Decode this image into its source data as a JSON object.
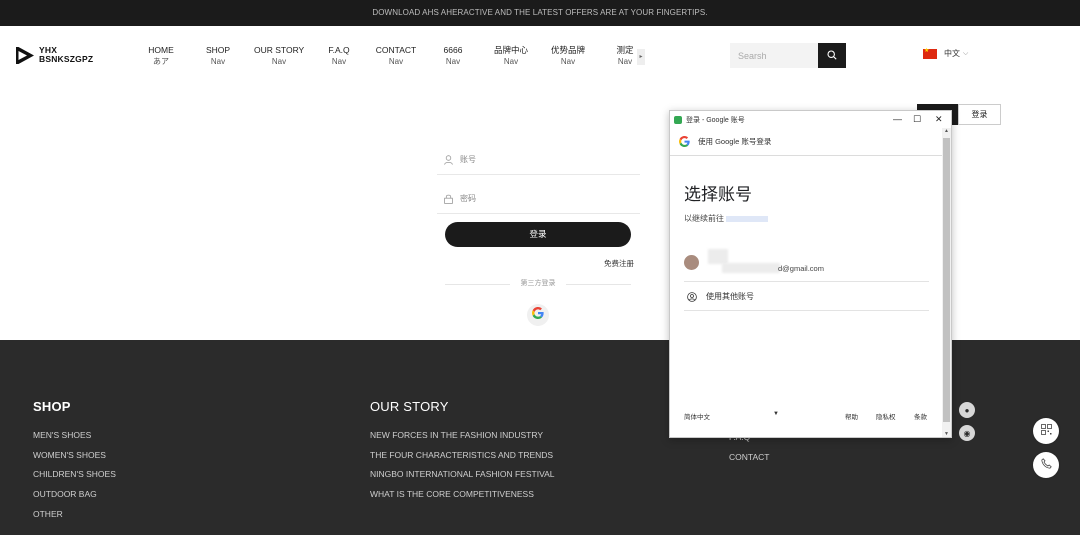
{
  "announcement": "DOWNLOAD AHS AHERACTIVE AND THE LATEST OFFERS ARE AT YOUR FINGERTIPS.",
  "logo": {
    "line1": "YHX",
    "line2": "BSNKSZGPZ"
  },
  "nav": [
    {
      "label": "HOME",
      "sub": "あア"
    },
    {
      "label": "SHOP",
      "sub": "Nav"
    },
    {
      "label": "OUR STORY",
      "sub": "Nav"
    },
    {
      "label": "F.A.Q",
      "sub": "Nav"
    },
    {
      "label": "CONTACT",
      "sub": "Nav"
    },
    {
      "label": "6666",
      "sub": "Nav"
    },
    {
      "label": "品牌中心",
      "sub": "Nav"
    },
    {
      "label": "优势品牌",
      "sub": "Nav"
    },
    {
      "label": "测定",
      "sub": "Nav"
    }
  ],
  "search": {
    "placeholder": "Searsh"
  },
  "language": {
    "label": "中文"
  },
  "header_buttons": {
    "login": "登录"
  },
  "login_form": {
    "username_placeholder": "账号",
    "password_placeholder": "密码",
    "submit": "登录",
    "register": "免费注册",
    "third_party": "第三方登录"
  },
  "popup": {
    "window_title": "登录 - Google 账号",
    "header": "使用 Google 账号登录",
    "heading": "选择账号",
    "continue_to": "以继续前往",
    "account_email": "d@gmail.com",
    "use_other": "使用其他账号",
    "footer_lang": "简体中文",
    "help": "帮助",
    "privacy": "隐私权",
    "terms": "条款"
  },
  "footer": {
    "shop": {
      "title": "SHOP",
      "links": [
        "MEN'S SHOES",
        "WOMEN'S SHOES",
        "CHILDREN'S SHOES",
        "OUTDOOR BAG",
        "OTHER"
      ]
    },
    "story": {
      "title": "OUR STORY",
      "links": [
        "NEW FORCES IN THE FASHION INDUSTRY",
        "THE FOUR CHARACTERISTICS AND TRENDS",
        "NINGBO INTERNATIONAL FASHION FESTIVAL",
        "WHAT IS THE CORE COMPETITIVENESS"
      ]
    },
    "help": {
      "links": [
        "F.A.Q",
        "CONTACT"
      ]
    }
  },
  "colors": {
    "dark": "#1b1b1b",
    "footer_bg": "#2b2b2b",
    "google_blue": "#4285f4"
  }
}
